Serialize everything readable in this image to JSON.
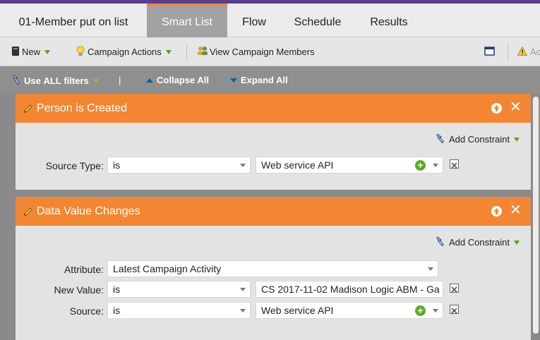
{
  "tabs": [
    {
      "label": "01-Member put on list"
    },
    {
      "label": "Smart List"
    },
    {
      "label": "Flow"
    },
    {
      "label": "Schedule"
    },
    {
      "label": "Results"
    }
  ],
  "toolbar": {
    "new_label": "New",
    "campaign_actions_label": "Campaign Actions",
    "view_members_label": "View Campaign Members",
    "right_partial_label": "Ac"
  },
  "filterbar": {
    "use_prefix": "Use ",
    "use_all": "ALL",
    "use_suffix": " filters",
    "separator": "|",
    "collapse_label": "Collapse All",
    "expand_label": "Expand All"
  },
  "filters": [
    {
      "title": "Person is Created",
      "add_constraint_label": "Add Constraint",
      "rows": [
        {
          "label": "Source Type:",
          "operator": "is",
          "value": "Web service API"
        }
      ]
    },
    {
      "title": "Data Value Changes",
      "add_constraint_label": "Add Constraint",
      "attribute_label": "Attribute:",
      "attribute_value": "Latest Campaign Activity",
      "rows": [
        {
          "label": "New Value:",
          "operator": "is",
          "value": "CS 2017-11-02 Madison Logic ABM - Ga"
        },
        {
          "label": "Source:",
          "operator": "is",
          "value": "Web service API"
        }
      ]
    }
  ],
  "colors": {
    "accent_orange": "#f38632",
    "active_tab": "#a2a2a2",
    "green_triangle": "#5da01f",
    "link_blue": "#0e5fa8"
  },
  "icons": {
    "pencil": "pencil-icon",
    "up": "move-up-icon",
    "close": "close-icon",
    "add": "plus-circle-icon",
    "delete": "delete-row-icon",
    "constraint": "wrench-icon"
  }
}
